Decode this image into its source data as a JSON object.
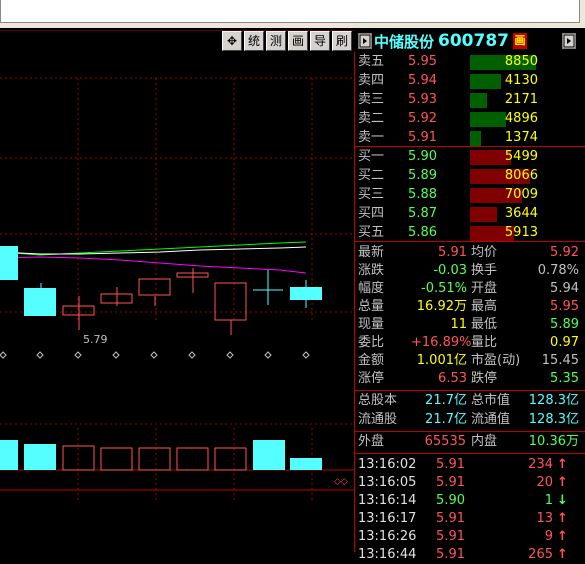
{
  "header": {
    "stock_name": "中储股份",
    "stock_code": "600787",
    "badge": "画"
  },
  "toolbar": {
    "move_glyph": "✥",
    "items": [
      "统",
      "测",
      "画",
      "导",
      "刷"
    ]
  },
  "chart": {
    "price_label": "5.79"
  },
  "sell_orders": [
    {
      "label": "卖五",
      "price": "5.95",
      "volume": "8850",
      "fill": 1.0
    },
    {
      "label": "卖四",
      "price": "5.94",
      "volume": "4130",
      "fill": 0.47
    },
    {
      "label": "卖三",
      "price": "5.93",
      "volume": "2171",
      "fill": 0.25
    },
    {
      "label": "卖二",
      "price": "5.92",
      "volume": "4896",
      "fill": 0.55
    },
    {
      "label": "卖一",
      "price": "5.91",
      "volume": "1374",
      "fill": 0.16
    }
  ],
  "buy_orders": [
    {
      "label": "买一",
      "price": "5.90",
      "volume": "5499",
      "fill": 0.62
    },
    {
      "label": "买二",
      "price": "5.89",
      "volume": "8066",
      "fill": 0.91
    },
    {
      "label": "买三",
      "price": "5.88",
      "volume": "7009",
      "fill": 0.79
    },
    {
      "label": "买四",
      "price": "5.87",
      "volume": "3644",
      "fill": 0.41
    },
    {
      "label": "买五",
      "price": "5.86",
      "volume": "5913",
      "fill": 0.67
    }
  ],
  "stats": [
    {
      "l1": "最新",
      "v1": "5.91",
      "c1": "r",
      "l2": "均价",
      "v2": "5.92",
      "c2": "r"
    },
    {
      "l1": "涨跌",
      "v1": "-0.03",
      "c1": "g",
      "l2": "换手",
      "v2": "0.78%",
      "c2": "w"
    },
    {
      "l1": "幅度",
      "v1": "-0.51%",
      "c1": "g",
      "l2": "开盘",
      "v2": "5.94",
      "c2": "w"
    },
    {
      "l1": "总量",
      "v1": "16.92万",
      "c1": "y",
      "l2": "最高",
      "v2": "5.95",
      "c2": "r"
    },
    {
      "l1": "现量",
      "v1": "11",
      "c1": "y",
      "l2": "最低",
      "v2": "5.89",
      "c2": "g"
    },
    {
      "l1": "委比",
      "v1": "+16.89%",
      "c1": "r",
      "l2": "量比",
      "v2": "0.97",
      "c2": "y"
    },
    {
      "l1": "金额",
      "v1": "1.001亿",
      "c1": "y",
      "l2": "市盈(动)",
      "v2": "15.45",
      "c2": "w"
    },
    {
      "l1": "涨停",
      "v1": "6.53",
      "c1": "r",
      "l2": "跌停",
      "v2": "5.35",
      "c2": "g"
    }
  ],
  "capital": [
    {
      "l1": "总股本",
      "v1": "21.7亿",
      "l2": "总市值",
      "v2": "128.3亿"
    },
    {
      "l1": "流通股",
      "v1": "21.7亿",
      "l2": "流通值",
      "v2": "128.3亿"
    }
  ],
  "outer_inner": {
    "outer_label": "外盘",
    "outer_value": "65535",
    "inner_label": "内盘",
    "inner_value": "10.36万"
  },
  "ticks": [
    {
      "time": "13:16:02",
      "price": "5.91",
      "pc": "r",
      "vol": "234",
      "dir": "up"
    },
    {
      "time": "13:16:05",
      "price": "5.91",
      "pc": "r",
      "vol": "20",
      "dir": "up"
    },
    {
      "time": "13:16:14",
      "price": "5.90",
      "pc": "g",
      "vol": "1",
      "dir": "down"
    },
    {
      "time": "13:16:17",
      "price": "5.91",
      "pc": "r",
      "vol": "13",
      "dir": "up"
    },
    {
      "time": "13:16:26",
      "price": "5.91",
      "pc": "r",
      "vol": "9",
      "dir": "up"
    },
    {
      "time": "13:16:44",
      "price": "5.91",
      "pc": "r",
      "vol": "265",
      "dir": "up"
    }
  ],
  "colors": {
    "up": "#ff5555",
    "down": "#55ffff",
    "grid": "#c00000",
    "ma1": "#ffffff",
    "ma2": "#00ff00",
    "ma3": "#ff00ff"
  }
}
